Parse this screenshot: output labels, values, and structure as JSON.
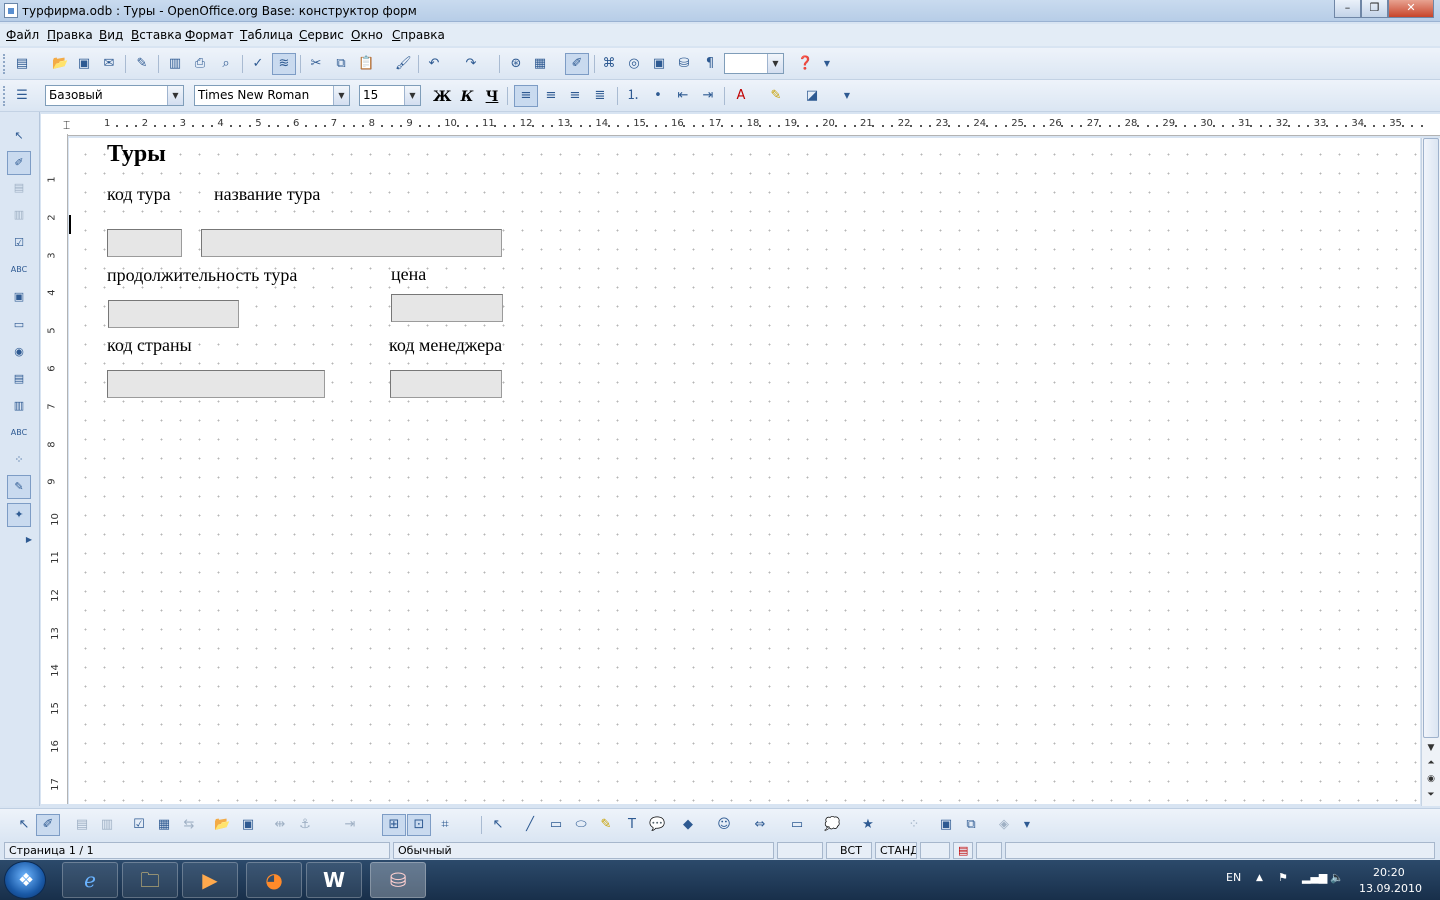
{
  "window": {
    "title": "турфирма.odb : Туры - OpenOffice.org Base: конструктор форм",
    "buttons": {
      "minimize": "–",
      "maximize": "❐",
      "close": "✕"
    }
  },
  "menu": [
    "Файл",
    "Правка",
    "Вид",
    "Вставка",
    "Формат",
    "Таблица",
    "Сервис",
    "Окно",
    "Справка"
  ],
  "format_toolbar": {
    "style": "Базовый",
    "font": "Times New Roman",
    "size": "15",
    "bold": "Ж",
    "italic": "К",
    "underline": "Ч"
  },
  "ruler": {
    "h_numbers": [
      "1",
      "2",
      "3",
      "4",
      "5",
      "6",
      "7",
      "8",
      "9",
      "10",
      "11",
      "12",
      "13",
      "14",
      "15",
      "16",
      "17",
      "18",
      "19",
      "20",
      "21",
      "22",
      "23",
      "24",
      "25",
      "26",
      "27",
      "28",
      "29",
      "30",
      "31",
      "32",
      "33",
      "34",
      "35"
    ],
    "v_numbers": [
      "1",
      "2",
      "3",
      "4",
      "5",
      "6",
      "7",
      "8",
      "9",
      "10",
      "11",
      "12",
      "13",
      "14",
      "15",
      "16",
      "17"
    ]
  },
  "form": {
    "title": "Туры",
    "label_tour_code": "код тура",
    "label_tour_name": "название тура",
    "label_duration": "продолжительность тура",
    "label_price": "цена",
    "label_country_code": "код страны",
    "label_manager_code": "код менеджера"
  },
  "status_bar": {
    "page": "Страница 1 / 1",
    "style": "Обычный",
    "insert_mode": "ВСТ",
    "selection_mode": "СТАНД"
  },
  "taskbar": {
    "language": "EN",
    "time": "20:20",
    "date": "13.09.2010"
  },
  "colors": {
    "accent": "#2e5a92",
    "field_bg": "#e6e6e6",
    "taskbar": "#1f3a5a"
  }
}
